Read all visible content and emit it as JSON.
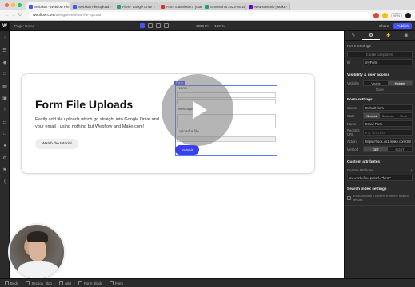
{
  "browser": {
    "tabs": [
      {
        "label": "Webflow - Webflow File",
        "active": true,
        "color": "#4353ff"
      },
      {
        "label": "Webflow File Upload",
        "active": false,
        "color": "#4353ff"
      },
      {
        "label": "Files - Google Drive",
        "active": false,
        "color": "#1fa463"
      },
      {
        "label": "Form Submission - jutardi",
        "active": false,
        "color": "#d93025"
      },
      {
        "label": "Screenshot 2023-08-15 at",
        "active": false,
        "color": "#1fa463"
      },
      {
        "label": "New scenario | Make",
        "active": false,
        "color": "#6d00cc"
      }
    ],
    "url": {
      "domain": "webflow.com",
      "path": "/design/webflow-file-upload"
    },
    "vpn": "VPN"
  },
  "toolbar": {
    "logo": "W",
    "page_label": "Page: Home",
    "width": "1099",
    "width_unit": "PX",
    "zoom": "100",
    "zoom_unit": "%",
    "share": "Share",
    "publish": "Publish"
  },
  "canvas": {
    "heading": "Form File Uploads",
    "subtext": "Easily add file uploads which go straight into Google Drive and your email - using nothing but Webflow and Make.com!",
    "tutorial_button": "Watch the tutorial",
    "form_tag": "Form",
    "fields": [
      {
        "label": "Name"
      },
      {
        "label": "Message"
      },
      {
        "label": "Upload a file"
      }
    ],
    "submit": "Submit"
  },
  "panel": {
    "form_settings_title": "Form Settings",
    "create_component": "Create component",
    "id_label": "ID",
    "id_value": "myForm",
    "visibility_title": "Visibility & user access",
    "visibility_label": "Visibility",
    "visibility_options": [
      "Visible",
      "Hidden"
    ],
    "visibility_active": "Hidden",
    "none_label": "None",
    "form_settings_h": "Form settings",
    "source_label": "Source",
    "source_value": "Default form",
    "state_label": "State",
    "state_options": [
      "Normal",
      "Success",
      "Error"
    ],
    "state_active": "Normal",
    "name_label": "Name",
    "name_value": "Email Form",
    "redirect_label": "Redirect URL",
    "redirect_placeholder": "e.g. /success",
    "action_label": "Action",
    "action_value": "https://hook.us1.make.com/38l",
    "method_label": "Method",
    "method_options": [
      "GET",
      "POST"
    ],
    "method_active": "GET",
    "custom_attr_title": "Custom attributes",
    "custom_attr_label": "Custom Attributes",
    "custom_attr_value": "ms-code-file-upload= \"form\"",
    "search_index_title": "Search index settings",
    "search_index_text": "Exclude form's content from the search results"
  },
  "breadcrumbs": [
    "Body",
    "Section_blog",
    "grid",
    "Form Block",
    "Form"
  ]
}
